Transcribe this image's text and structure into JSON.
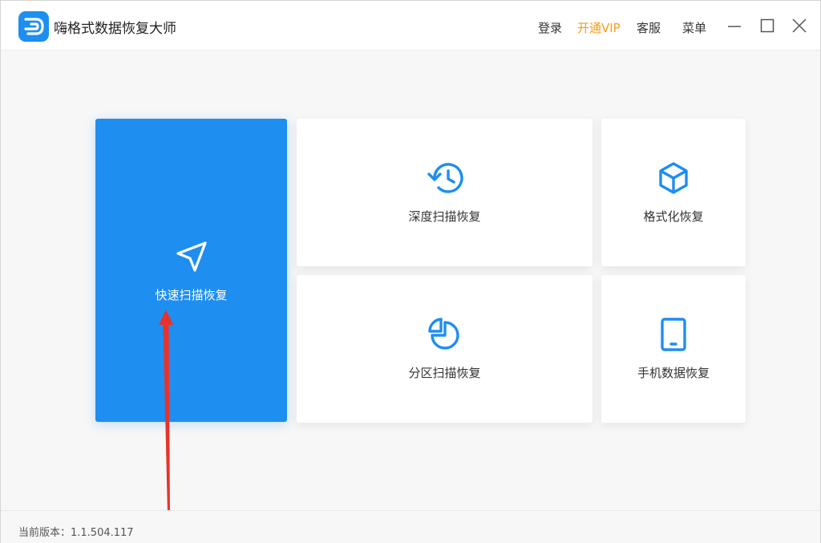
{
  "app": {
    "title": "嗨格式数据恢复大师",
    "logo_icon": "d-logo-icon"
  },
  "titlebar": {
    "login_label": "登录",
    "vip_label": "开通VIP",
    "service_label": "客服",
    "menu_label": "菜单"
  },
  "modes": {
    "quick": {
      "label": "快速扫描恢复",
      "icon": "navigation-arrow-icon"
    },
    "deep": {
      "label": "深度扫描恢复",
      "icon": "history-clock-icon"
    },
    "format": {
      "label": "格式化恢复",
      "icon": "cube-icon"
    },
    "partition": {
      "label": "分区扫描恢复",
      "icon": "pie-chart-icon"
    },
    "phone": {
      "label": "手机数据恢复",
      "icon": "tablet-icon"
    }
  },
  "footer": {
    "version_text": "当前版本：1.1.504.117"
  },
  "colors": {
    "accent": "#1e8ef0",
    "vip": "#f39c12",
    "annotation_arrow": "#e8322b"
  }
}
